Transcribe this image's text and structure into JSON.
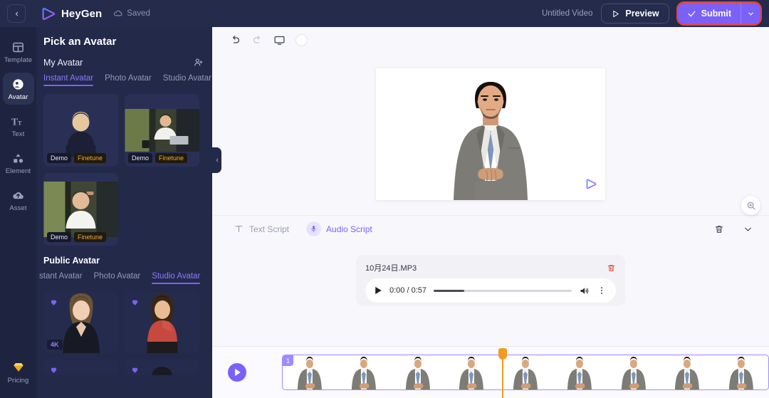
{
  "topbar": {
    "back_icon": "chevron-left-icon",
    "brand": "HeyGen",
    "saved_label": "Saved",
    "saved_icon": "cloud-check-icon",
    "video_title": "Untitled Video",
    "preview_label": "Preview",
    "preview_icon": "play-outline-icon",
    "submit_label": "Submit",
    "submit_icon": "check-icon",
    "submit_caret_icon": "chevron-down-icon",
    "accent": "#7b61f8",
    "highlight_outline": "#f4402a"
  },
  "rail": {
    "items": [
      {
        "label": "Template",
        "icon": "template-icon",
        "active": false
      },
      {
        "label": "Avatar",
        "icon": "avatar-icon",
        "active": true
      },
      {
        "label": "Text",
        "icon": "text-icon",
        "active": false
      },
      {
        "label": "Element",
        "icon": "element-icon",
        "active": false
      },
      {
        "label": "Asset",
        "icon": "asset-upload-icon",
        "active": false
      }
    ],
    "bottom": {
      "label": "Pricing",
      "icon": "diamond-icon"
    }
  },
  "panel": {
    "title": "Pick an Avatar",
    "my_avatar_label": "My Avatar",
    "add_avatar_icon": "add-person-icon",
    "my_tabs": [
      {
        "label": "Instant Avatar",
        "active": true
      },
      {
        "label": "Photo Avatar",
        "active": false
      },
      {
        "label": "Studio Avatar",
        "active": false
      }
    ],
    "my_cards": [
      {
        "demo_label": "Demo",
        "finetune_label": "Finetune",
        "style": "blonde-dark"
      },
      {
        "demo_label": "Demo",
        "finetune_label": "Finetune",
        "style": "desk-laptop"
      },
      {
        "demo_label": "Demo",
        "finetune_label": "Finetune",
        "style": "cafe-white"
      }
    ],
    "public_section_title": "Public Avatar",
    "public_tabs": [
      {
        "label": "stant Avatar",
        "active": false
      },
      {
        "label": "Photo Avatar",
        "active": false
      },
      {
        "label": "Studio Avatar",
        "active": true
      }
    ],
    "public_cards": [
      {
        "heart_icon": "heart-icon",
        "res_badge": "4K",
        "style": "woman-black"
      },
      {
        "heart_icon": "heart-icon",
        "res_badge": "",
        "style": "woman-red"
      },
      {
        "heart_icon": "heart-icon",
        "res_badge": "",
        "style": "dark-row"
      },
      {
        "heart_icon": "heart-icon",
        "res_badge": "",
        "style": "dark-row2"
      }
    ],
    "collapse_icon": "chevron-left-icon"
  },
  "editor": {
    "toolbar": [
      {
        "name": "undo-button",
        "icon": "undo-icon",
        "disabled": false
      },
      {
        "name": "redo-button",
        "icon": "redo-icon",
        "disabled": true
      },
      {
        "name": "screen-button",
        "icon": "monitor-icon",
        "disabled": false
      },
      {
        "name": "shape-toggle",
        "icon": "circle-icon",
        "disabled": false
      }
    ],
    "canvas": {
      "watermark": "heygen-watermark-icon"
    },
    "zoom_icon": "zoom-in-icon"
  },
  "script": {
    "tabs": [
      {
        "label": "Text Script",
        "icon": "text-t-icon",
        "active": false
      },
      {
        "label": "Audio Script",
        "icon": "microphone-icon",
        "active": true
      }
    ],
    "delete_icon": "trash-icon",
    "collapse_icon": "chevron-down-icon",
    "audio": {
      "file_name": "10月24日.MP3",
      "delete_icon": "trash-icon",
      "play_icon": "play-icon",
      "time": "0:00 / 0:57",
      "current_time": "0:00",
      "duration": "0:57",
      "progress_percent": 22,
      "volume_icon": "volume-icon",
      "more_icon": "kebab-menu-icon"
    }
  },
  "timeline": {
    "play_icon": "play-circle-icon",
    "scene_number": "1",
    "frame_count": 9,
    "playhead_color": "#f59a1e"
  }
}
